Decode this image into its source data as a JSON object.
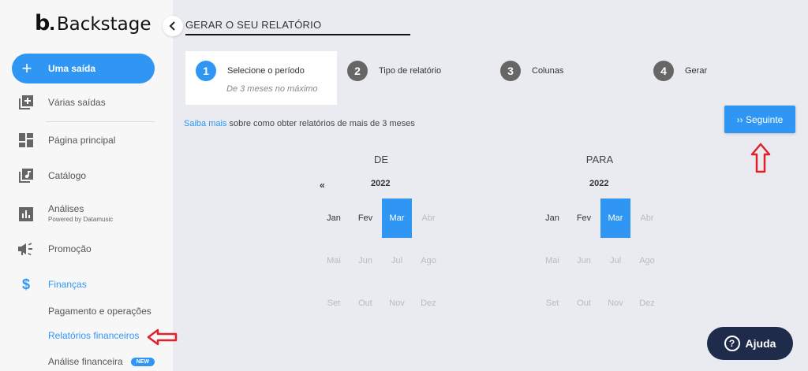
{
  "brand": {
    "mark": "b",
    "name": "Backstage"
  },
  "sidebar": {
    "new_button": "Uma saída",
    "items": [
      {
        "label": "Várias saídas",
        "icon": "add-box-icon"
      },
      {
        "label": "Página principal",
        "icon": "dashboard-icon"
      },
      {
        "label": "Catálogo",
        "icon": "music-library-icon"
      },
      {
        "label": "Análises",
        "sub": "Powered by Datamusic",
        "icon": "bar-chart-icon"
      },
      {
        "label": "Promoção",
        "icon": "megaphone-icon"
      },
      {
        "label": "Finanças",
        "icon": "dollar-icon"
      }
    ],
    "finance_sub": [
      {
        "label": "Pagamento e operações"
      },
      {
        "label": "Relatórios financeiros"
      },
      {
        "label": "Análise financeira",
        "badge": "NEW"
      }
    ]
  },
  "page": {
    "title": "GERAR O SEU RELATÓRIO"
  },
  "steps": [
    {
      "num": "1",
      "title": "Selecione o período",
      "sub": "De 3 meses no máximo"
    },
    {
      "num": "2",
      "title": "Tipo de relatório"
    },
    {
      "num": "3",
      "title": "Colunas"
    },
    {
      "num": "4",
      "title": "Gerar"
    }
  ],
  "info": {
    "link": "Saiba mais",
    "text": " sobre como obter relatórios de mais de 3 meses"
  },
  "next_button": "›› Seguinte",
  "calendar": {
    "from": {
      "label": "DE",
      "year": "2022",
      "prev": "«"
    },
    "to": {
      "label": "PARA",
      "year": "2022"
    },
    "months": [
      "Jan",
      "Fev",
      "Mar",
      "Abr",
      "Mai",
      "Jun",
      "Jul",
      "Ago",
      "Set",
      "Out",
      "Nov",
      "Dez"
    ],
    "selected": "Mar"
  },
  "help_button": "Ajuda",
  "colors": {
    "accent": "#2f97f3",
    "help_bg": "#1f2b4b",
    "annotation": "#e0202a"
  }
}
